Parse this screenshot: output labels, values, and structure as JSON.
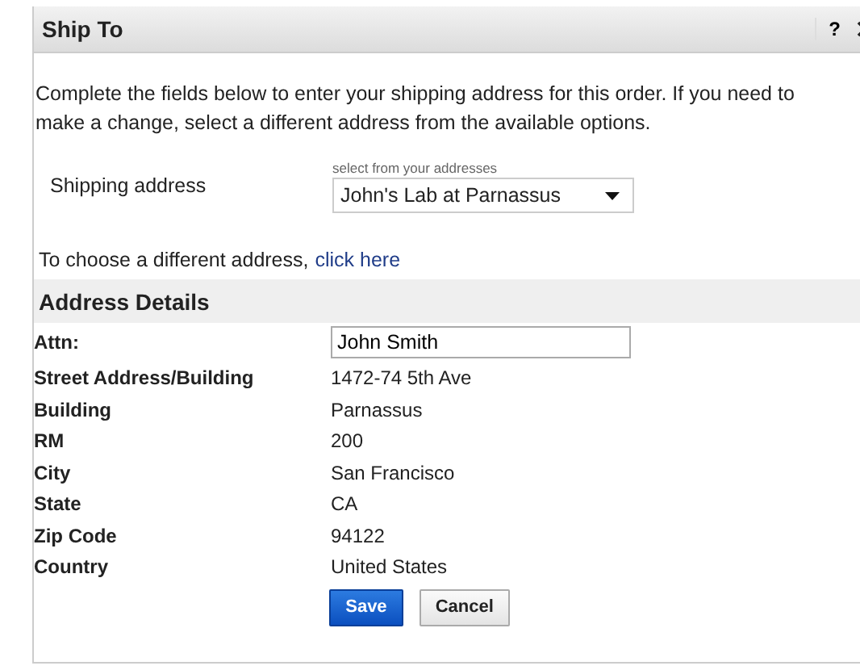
{
  "dialog": {
    "title": "Ship To",
    "help": "?"
  },
  "intro": "Complete the fields below to enter your shipping address for this order. If you need to make a change, select a different address from the available options.",
  "shipping": {
    "label": "Shipping address",
    "hint": "select from your addresses",
    "value": "John's Lab at Parnassus"
  },
  "change": {
    "text": "To choose a different address,",
    "link": "click here"
  },
  "details": {
    "heading": "Address Details",
    "attn": {
      "label": "Attn:",
      "value": "John Smith"
    },
    "rows": [
      {
        "label": "Street Address/Building",
        "value": "1472-74 5th Ave"
      },
      {
        "label": "Building",
        "value": "Parnassus"
      },
      {
        "label": "RM",
        "value": "200"
      },
      {
        "label": "City",
        "value": "San Francisco"
      },
      {
        "label": "State",
        "value": "CA"
      },
      {
        "label": "Zip Code",
        "value": "94122"
      },
      {
        "label": "Country",
        "value": "United States"
      }
    ]
  },
  "buttons": [
    {
      "label": "Save",
      "kind": "primary"
    },
    {
      "label": "Cancel",
      "kind": "secondary"
    }
  ]
}
